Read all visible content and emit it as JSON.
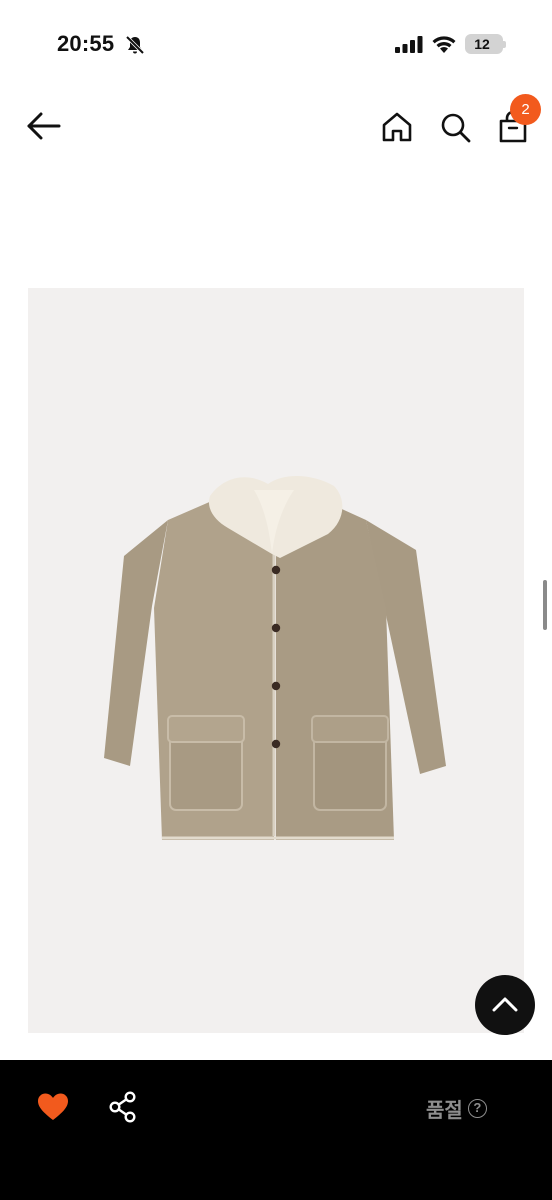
{
  "status_bar": {
    "time": "20:55",
    "battery": "12"
  },
  "header": {
    "cart_count": "2"
  },
  "product": {
    "image_icon": "coat-image"
  },
  "footer": {
    "soldout_label": "품절",
    "help_icon_glyph": "?"
  },
  "colors": {
    "accent": "#f25a1d",
    "bottom_bar": "#000000",
    "soldout_text": "#8e8e8e",
    "image_bg": "#f2f0ef"
  }
}
